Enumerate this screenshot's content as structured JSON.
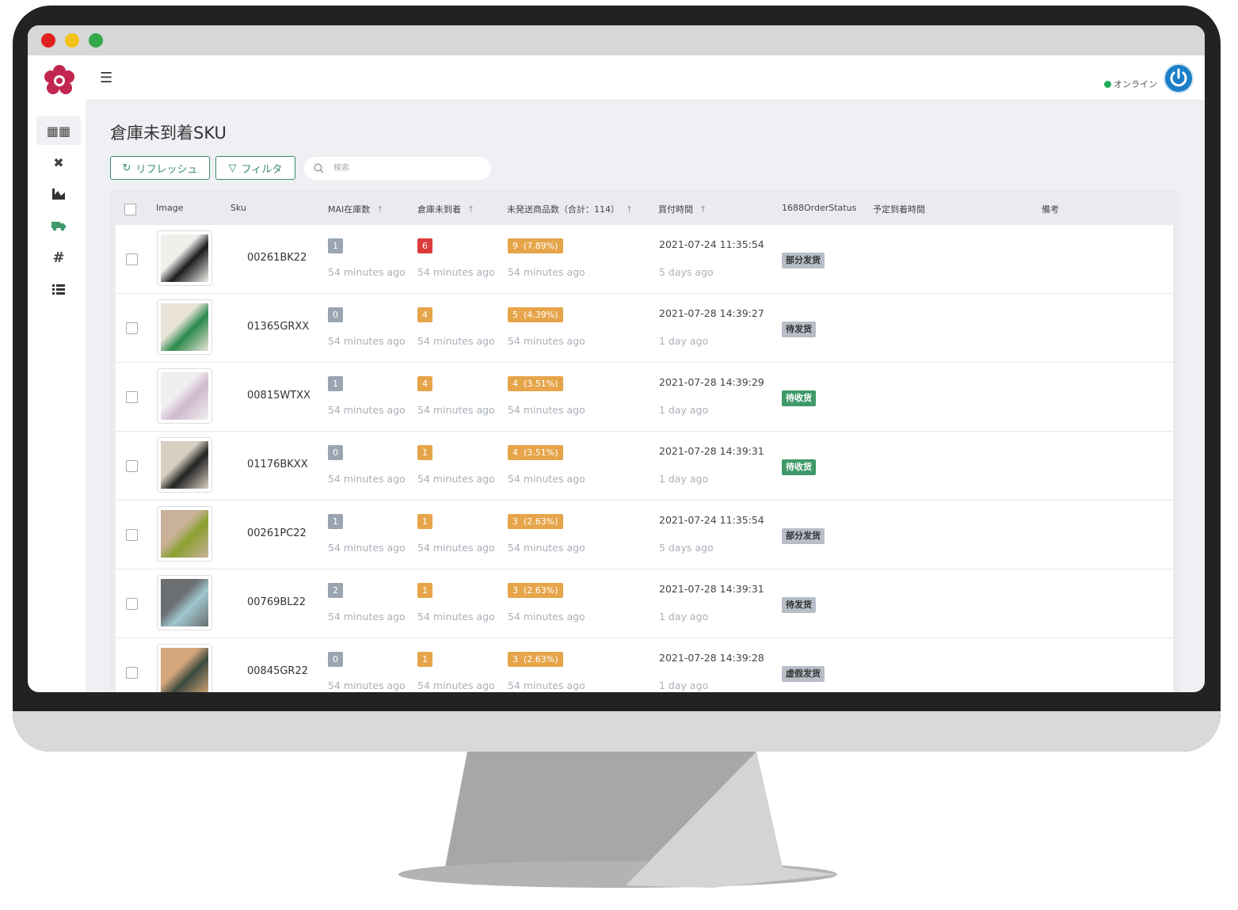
{
  "app": {
    "header": {
      "status": "オンライン"
    },
    "page_title": "倉庫未到着SKU",
    "toolbar": {
      "refresh_label": "リフレッシュ",
      "filter_label": "フィルタ"
    },
    "search": {
      "placeholder": "検索"
    },
    "table": {
      "columns": {
        "image": "Image",
        "sku": "Sku",
        "mai_stock": "MAI在庫数",
        "not_arrived": "倉庫未到着",
        "unshipped": "未発送商品数（合計：114）",
        "purchase_time": "買付時間",
        "order_status": "1688OrderStatus",
        "eta": "予定到着時間",
        "note": "備考"
      },
      "rows": [
        {
          "sku": "00261BK22",
          "mai": "1",
          "mai_ago": "54 minutes ago",
          "arr": "6",
          "arr_ago": "54 minutes ago",
          "uns": "9  (7.89%)",
          "uns_ago": "54 minutes ago",
          "date": "2021-07-24 11:35:54",
          "date_ago": "5 days ago",
          "status": "部分发货"
        },
        {
          "sku": "01365GRXX",
          "mai": "0",
          "mai_ago": "54 minutes ago",
          "arr": "4",
          "arr_ago": "54 minutes ago",
          "uns": "5  (4.39%)",
          "uns_ago": "54 minutes ago",
          "date": "2021-07-28 14:39:27",
          "date_ago": "1 day ago",
          "status": "待发货"
        },
        {
          "sku": "00815WTXX",
          "mai": "1",
          "mai_ago": "54 minutes ago",
          "arr": "4",
          "arr_ago": "54 minutes ago",
          "uns": "4  (3.51%)",
          "uns_ago": "54 minutes ago",
          "date": "2021-07-28 14:39:29",
          "date_ago": "1 day ago",
          "status": "待收货"
        },
        {
          "sku": "01176BKXX",
          "mai": "0",
          "mai_ago": "54 minutes ago",
          "arr": "1",
          "arr_ago": "54 minutes ago",
          "uns": "4  (3.51%)",
          "uns_ago": "54 minutes ago",
          "date": "2021-07-28 14:39:31",
          "date_ago": "1 day ago",
          "status": "待收货"
        },
        {
          "sku": "00261PC22",
          "mai": "1",
          "mai_ago": "54 minutes ago",
          "arr": "1",
          "arr_ago": "54 minutes ago",
          "uns": "3  (2.63%)",
          "uns_ago": "54 minutes ago",
          "date": "2021-07-24 11:35:54",
          "date_ago": "5 days ago",
          "status": "部分发货"
        },
        {
          "sku": "00769BL22",
          "mai": "2",
          "mai_ago": "54 minutes ago",
          "arr": "1",
          "arr_ago": "54 minutes ago",
          "uns": "3  (2.63%)",
          "uns_ago": "54 minutes ago",
          "date": "2021-07-28 14:39:31",
          "date_ago": "1 day ago",
          "status": "待发货"
        },
        {
          "sku": "00845GR22",
          "mai": "0",
          "mai_ago": "54 minutes ago",
          "arr": "1",
          "arr_ago": "54 minutes ago",
          "uns": "3  (2.63%)",
          "uns_ago": "54 minutes ago",
          "date": "2021-07-28 14:39:28",
          "date_ago": "1 day ago",
          "status": "虚假发货"
        }
      ]
    }
  },
  "colors": {
    "accent": "#3a8a6e",
    "badge_red": "#dc3b3b",
    "badge_orange": "#e6a54a",
    "badge_grey": "#9aa5b1",
    "status_green": "#3f9a6a"
  },
  "icons": [
    "menu-icon",
    "refresh-icon",
    "filter-icon",
    "search-icon",
    "power-icon",
    "cubes-icon",
    "close-icon",
    "chart-icon",
    "truck-icon",
    "hashtag-icon",
    "list-icon",
    "sort-arrow-icon"
  ]
}
